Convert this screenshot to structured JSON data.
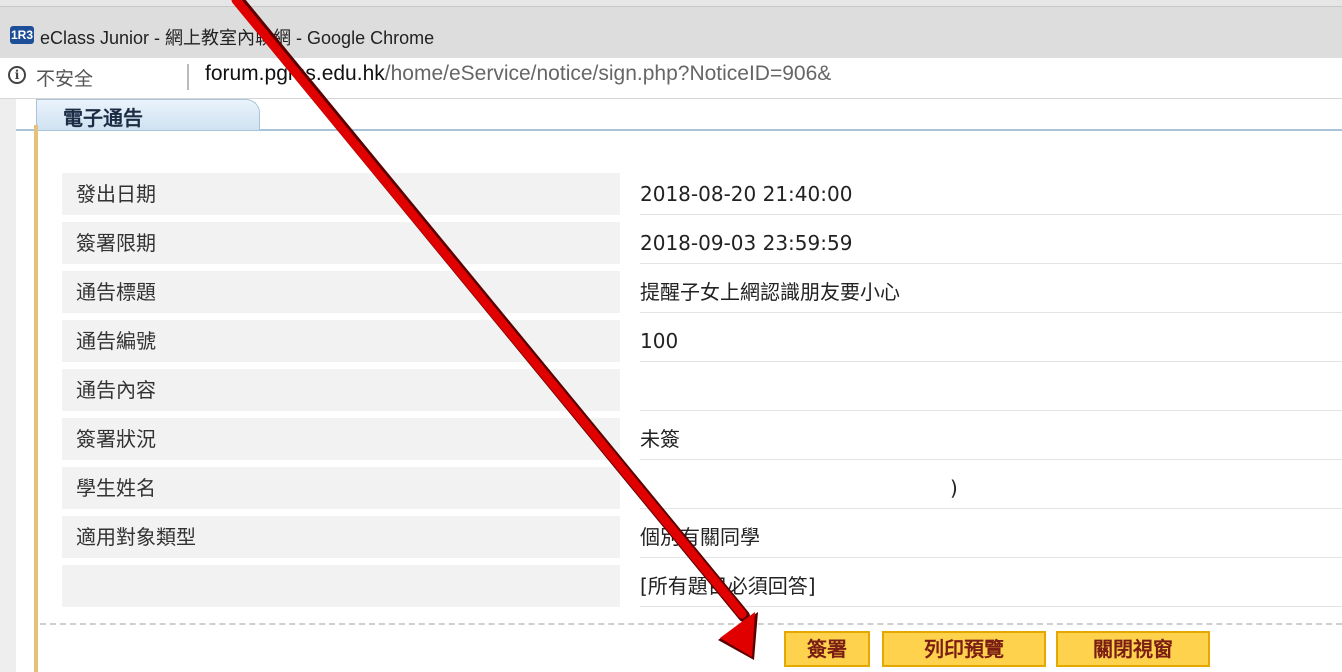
{
  "browser": {
    "app_icon_text": "1R3",
    "window_title": "eClass Junior - 網上教室內聯網 - Google Chrome",
    "security_label": "不安全",
    "url_host": "forum.pgms.edu.hk",
    "url_path": "/home/eService/notice/sign.php?NoticeID=906&"
  },
  "page": {
    "tab_title": "電子通告",
    "rows": [
      {
        "label": "發出日期",
        "value": "2018-08-20 21:40:00"
      },
      {
        "label": "簽署限期",
        "value": "2018-09-03 23:59:59"
      },
      {
        "label": "通告標題",
        "value": "提醒子女上網認識朋友要小心"
      },
      {
        "label": "通告編號",
        "value": "100"
      },
      {
        "label": "通告內容",
        "value": ""
      },
      {
        "label": "簽署狀況",
        "value": "未簽"
      },
      {
        "label": "學生姓名",
        "value": ")"
      },
      {
        "label": "適用對象類型",
        "value": "個別有關同學"
      },
      {
        "label": "",
        "value": "[所有題目必須回答]"
      }
    ],
    "buttons": {
      "sign": "簽署",
      "print_preview": "列印預覽",
      "close_window": "關閉視窗"
    }
  },
  "colors": {
    "annotation_arrow": "#e00000",
    "button_bg": "#ffd24d",
    "button_text": "#7a1d12",
    "tab_border": "#a9c4d8"
  }
}
